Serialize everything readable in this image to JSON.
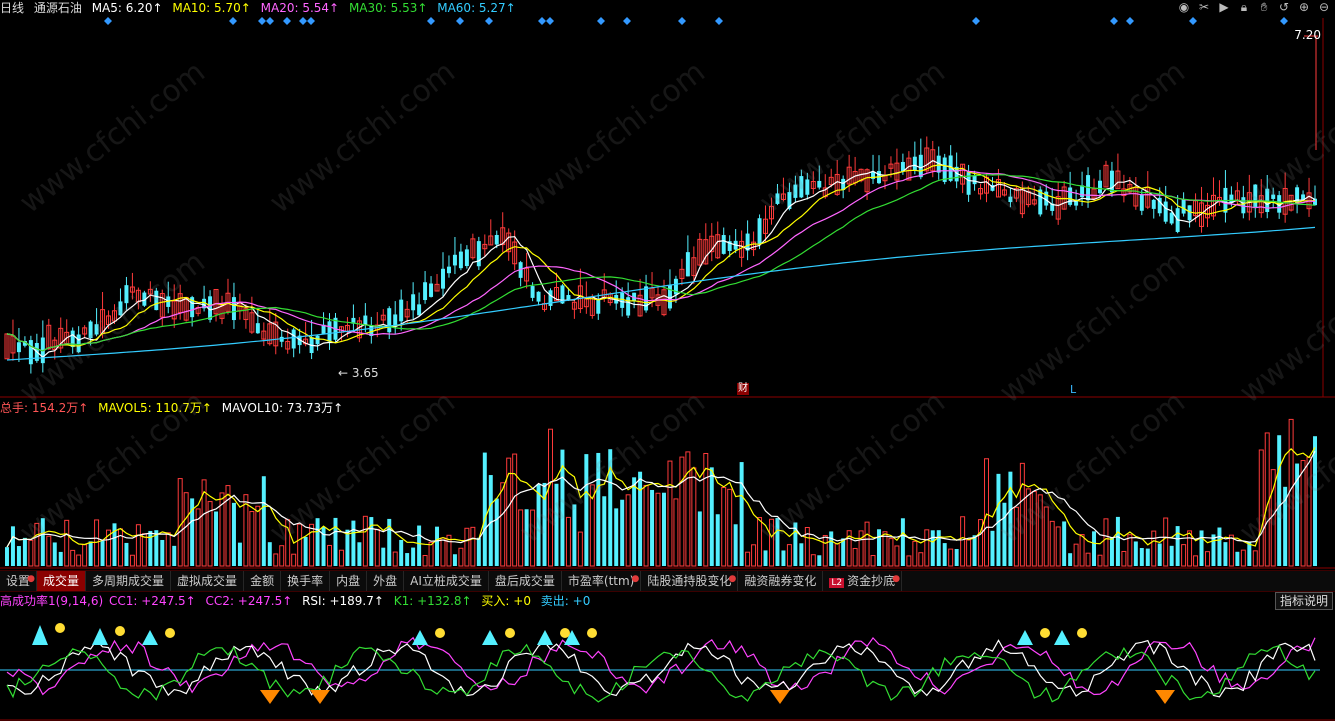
{
  "header": {
    "period": "日线",
    "stock_name": "通源石油",
    "ma": [
      {
        "label": "MA5: 6.20↑",
        "color": "#ffffff"
      },
      {
        "label": "MA10: 5.70↑",
        "color": "#ffff00"
      },
      {
        "label": "MA20: 5.54↑",
        "color": "#ff66ff"
      },
      {
        "label": "MA30: 5.53↑",
        "color": "#33dd33"
      },
      {
        "label": "MA60: 5.27↑",
        "color": "#33ccff"
      }
    ]
  },
  "top_icons": [
    "eye-icon",
    "scissors-icon",
    "play-icon",
    "lock-icon",
    "hand-icon",
    "undo-icon",
    "zoom-in-icon",
    "zoom-out-icon"
  ],
  "price_panel": {
    "high_label": "7.20",
    "low_label": "3.65",
    "cai_marker": "财",
    "l_marker": "L"
  },
  "volume_panel": {
    "legend": [
      {
        "label": "总手: 154.2万↑",
        "color": "#ff5555"
      },
      {
        "label": "MAVOL5: 110.7万↑",
        "color": "#ffff00"
      },
      {
        "label": "MAVOL10: 73.73万↑",
        "color": "#ffffff"
      }
    ]
  },
  "tabs": [
    {
      "label": "设置",
      "dot": true,
      "active": false
    },
    {
      "label": "成交量",
      "dot": false,
      "active": true
    },
    {
      "label": "多周期成交量",
      "dot": false,
      "active": false
    },
    {
      "label": "虚拟成交量",
      "dot": false,
      "active": false
    },
    {
      "label": "金额",
      "dot": false,
      "active": false
    },
    {
      "label": "换手率",
      "dot": false,
      "active": false
    },
    {
      "label": "内盘",
      "dot": false,
      "active": false
    },
    {
      "label": "外盘",
      "dot": false,
      "active": false
    },
    {
      "label": "AI立桩成交量",
      "dot": false,
      "active": false
    },
    {
      "label": "盘后成交量",
      "dot": false,
      "active": false
    },
    {
      "label": "市盈率(ttm)",
      "dot": true,
      "active": false
    },
    {
      "label": "陆股通持股变化",
      "dot": true,
      "active": false
    },
    {
      "label": "融资融券变化",
      "dot": false,
      "active": false
    },
    {
      "label": "资金抄底",
      "dot": true,
      "active": false,
      "badge": "L2"
    }
  ],
  "indicator_panel": {
    "legend": [
      {
        "label": "高成功率1(9,14,6)",
        "color": "#ff44ff"
      },
      {
        "label": "CC1: +247.5↑",
        "color": "#ff44ff"
      },
      {
        "label": "CC2: +247.5↑",
        "color": "#ff44ff"
      },
      {
        "label": "RSI: +189.7↑",
        "color": "#ffffff"
      },
      {
        "label": "K1: +132.8↑",
        "color": "#33dd33"
      },
      {
        "label": "买入: +0",
        "color": "#ffff00"
      },
      {
        "label": "卖出: +0",
        "color": "#33ccff"
      }
    ],
    "help_button": "指标说明"
  },
  "watermark": "www.cfchi.com"
}
